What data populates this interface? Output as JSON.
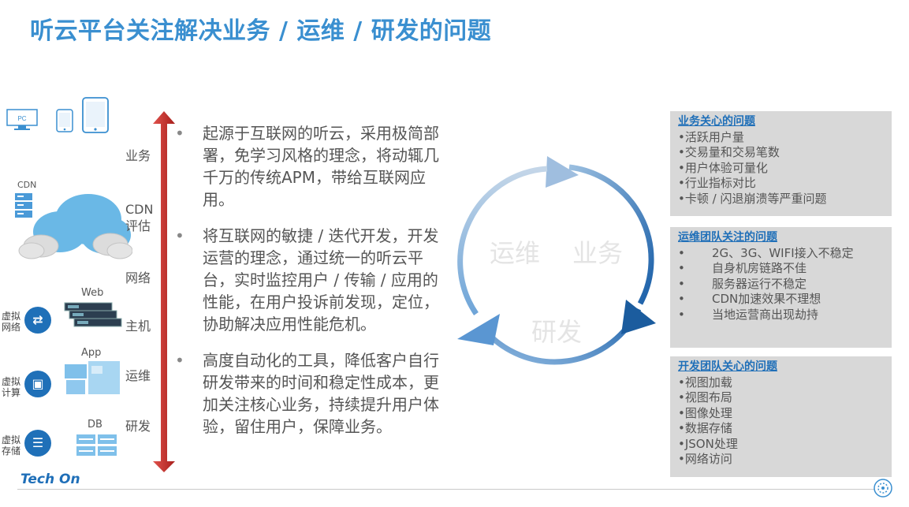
{
  "title": "听云平台关注解决业务 / 运维 / 研发的问题",
  "layers": {
    "business": "业务",
    "cdn": "CDN\n评估",
    "network": "网络",
    "host": "主机",
    "ops": "运维",
    "dev": "研发"
  },
  "icons": {
    "pc": "PC",
    "cdn": "CDN",
    "web": "Web",
    "app": "App",
    "db": "DB",
    "virtual_network": "虚拟网络",
    "virtual_compute": "虚拟计算",
    "virtual_storage": "虚拟存储"
  },
  "bullets": [
    "起源于互联网的听云，采用极简部署，免学习风格的理念，将动辄几千万的传统APM，带给互联网应用。",
    "将互联网的敏捷 / 迭代开发，开发运营的理念，通过统一的听云平台，实时监控用户 / 传输 / 应用的性能，在用户投诉前发现，定位，协助解决应用性能危机。",
    "高度自动化的工具，降低客户自行研发带来的时间和稳定性成本，更加关注核心业务，持续提升用户体验，留住用户，保障业务。"
  ],
  "cycle": {
    "ops": "运维",
    "business": "业务",
    "dev": "研发"
  },
  "boxes": {
    "business": {
      "header": "业务关心的问题",
      "items": [
        "•活跃用户量",
        "•交易量和交易笔数",
        "•用户体验可量化",
        "•行业指标对比",
        "•卡顿 / 闪退崩溃等严重问题"
      ]
    },
    "ops": {
      "header": "运维团队关注的问题",
      "items": [
        "2G、3G、WIFI接入不稳定",
        "自身机房链路不佳",
        "服务器运行不稳定",
        "CDN加速效果不理想",
        "当地运营商出现劫持"
      ]
    },
    "dev": {
      "header": "开发团队关心的问题",
      "items": [
        "•视图加载",
        "•视图布局",
        "•图像处理",
        "•数据存储",
        "•JSON处理",
        "•网络访问"
      ]
    }
  },
  "footer": {
    "logo": "Tech On"
  },
  "colors": {
    "title": "#3a8fd0",
    "arrow_red": "#c9302c",
    "box_bg": "#d8d8d8",
    "link_blue": "#1f6fb8"
  }
}
